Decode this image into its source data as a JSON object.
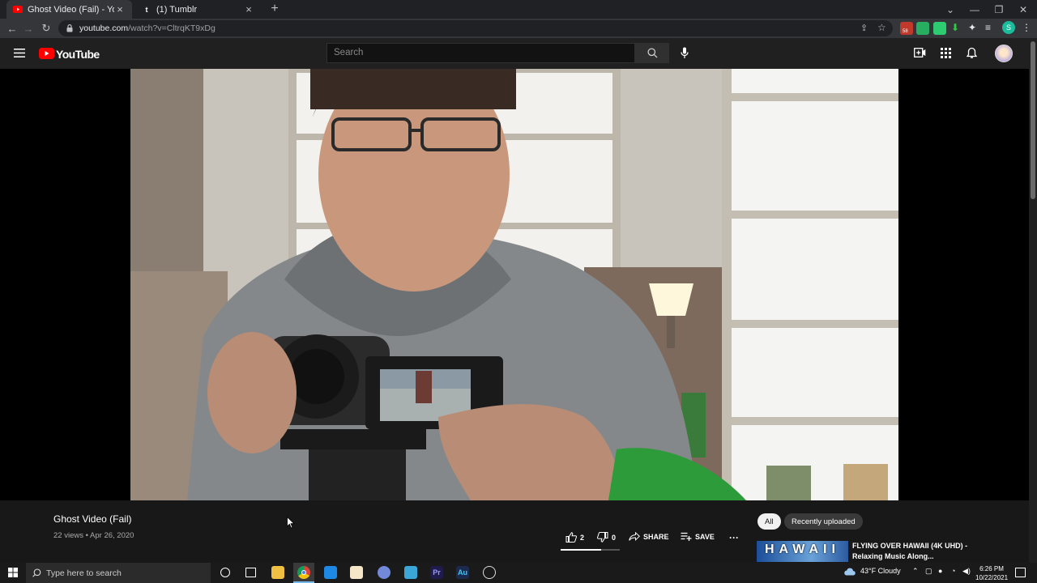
{
  "browser": {
    "tabs": [
      {
        "title": "Ghost Video (Fail) - YouTube",
        "active": true
      },
      {
        "title": "(1) Tumblr",
        "active": false
      }
    ],
    "new_tab": "+",
    "close": "×",
    "url_host": "youtube.com",
    "url_path": "/watch?v=CltrqKT9xDg",
    "profile_initial": "S",
    "ext_badge": "58"
  },
  "youtube": {
    "logo": "YouTube",
    "search_placeholder": "Search"
  },
  "video": {
    "title": "Ghost Video (Fail)",
    "meta": "22 views • Apr 26, 2020",
    "likes": "2",
    "dislikes": "0",
    "like_fraction": 0.68,
    "share_label": "SHARE",
    "save_label": "SAVE",
    "more_label": "···"
  },
  "sidebar": {
    "chips": [
      "All",
      "Recently uploaded"
    ],
    "rec_title": "FLYING OVER HAWAII (4K UHD) - Relaxing Music Along...",
    "rec_thumb_text": "HAWAII"
  },
  "taskbar": {
    "search_placeholder": "Type here to search",
    "weather": "43°F  Cloudy",
    "time": "6:26 PM",
    "date": "10/22/2021",
    "pr_label": "Pr",
    "au_label": "Au"
  }
}
